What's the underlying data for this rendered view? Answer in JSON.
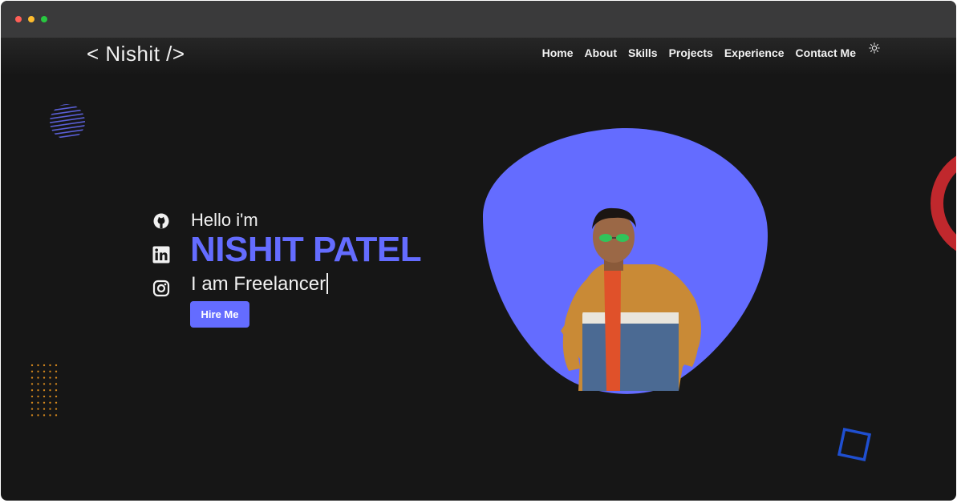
{
  "window": {
    "controls": [
      "close",
      "minimize",
      "maximize"
    ]
  },
  "brand": {
    "logo": "< Nishit />"
  },
  "nav": {
    "items": [
      {
        "label": "Home"
      },
      {
        "label": "About"
      },
      {
        "label": "Skills"
      },
      {
        "label": "Projects"
      },
      {
        "label": "Experience"
      },
      {
        "label": "Contact Me"
      }
    ],
    "theme_toggle_icon": "sun-icon"
  },
  "hero": {
    "greeting": "Hello i'm",
    "name": "NISHIT PATEL",
    "tagline": "I am Freelancer",
    "cta_label": "Hire Me",
    "photo_icon": "profile-photo"
  },
  "social": [
    {
      "icon": "github-icon"
    },
    {
      "icon": "linkedin-icon"
    },
    {
      "icon": "instagram-icon"
    }
  ],
  "colors": {
    "accent": "#646cff",
    "background": "#161616",
    "titlebar": "#3a3a3b",
    "ring": "#c0282d",
    "square": "#1f4fd0",
    "dots": "#d98a1c",
    "text": "#f1f1f1"
  }
}
